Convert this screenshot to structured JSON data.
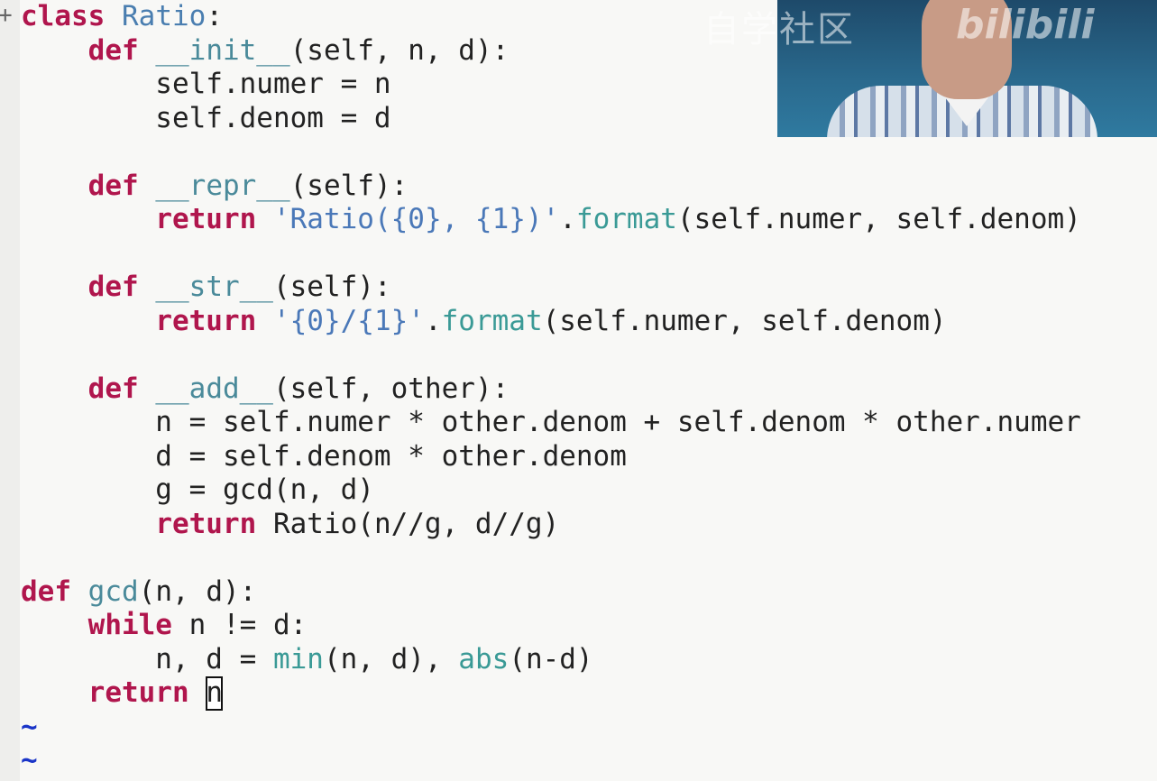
{
  "code_lines": [
    [
      {
        "t": "class",
        "c": "kw"
      },
      {
        "t": " "
      },
      {
        "t": "Ratio",
        "c": "cls"
      },
      {
        "t": ":"
      }
    ],
    [
      {
        "t": "    "
      },
      {
        "t": "def",
        "c": "kw"
      },
      {
        "t": " "
      },
      {
        "t": "__init__",
        "c": "fn"
      },
      {
        "t": "(self, n, d):"
      }
    ],
    [
      {
        "t": "        self.numer = n"
      }
    ],
    [
      {
        "t": "        self.denom = d"
      }
    ],
    [],
    [
      {
        "t": "    "
      },
      {
        "t": "def",
        "c": "kw"
      },
      {
        "t": " "
      },
      {
        "t": "__repr__",
        "c": "fn"
      },
      {
        "t": "(self):"
      }
    ],
    [
      {
        "t": "        "
      },
      {
        "t": "return",
        "c": "kw"
      },
      {
        "t": " "
      },
      {
        "t": "'Ratio({0}, {1})'",
        "c": "str"
      },
      {
        "t": "."
      },
      {
        "t": "format",
        "c": "builtin"
      },
      {
        "t": "(self.numer, self.denom)"
      }
    ],
    [],
    [
      {
        "t": "    "
      },
      {
        "t": "def",
        "c": "kw"
      },
      {
        "t": " "
      },
      {
        "t": "__str__",
        "c": "fn"
      },
      {
        "t": "(self):"
      }
    ],
    [
      {
        "t": "        "
      },
      {
        "t": "return",
        "c": "kw"
      },
      {
        "t": " "
      },
      {
        "t": "'{0}/{1}'",
        "c": "str"
      },
      {
        "t": "."
      },
      {
        "t": "format",
        "c": "builtin"
      },
      {
        "t": "(self.numer, self.denom)"
      }
    ],
    [],
    [
      {
        "t": "    "
      },
      {
        "t": "def",
        "c": "kw"
      },
      {
        "t": " "
      },
      {
        "t": "__add__",
        "c": "fn"
      },
      {
        "t": "(self, other):"
      }
    ],
    [
      {
        "t": "        n = self.numer * other.denom + self.denom * other.numer"
      }
    ],
    [
      {
        "t": "        d = self.denom * other.denom"
      }
    ],
    [
      {
        "t": "        g = gcd(n, d)"
      }
    ],
    [
      {
        "t": "        "
      },
      {
        "t": "return",
        "c": "kw"
      },
      {
        "t": " Ratio(n//g, d//g)"
      }
    ],
    [],
    [
      {
        "t": "def",
        "c": "kw"
      },
      {
        "t": " "
      },
      {
        "t": "gcd",
        "c": "fn"
      },
      {
        "t": "(n, d):"
      }
    ],
    [
      {
        "t": "    "
      },
      {
        "t": "while",
        "c": "kw"
      },
      {
        "t": " n != d:"
      }
    ],
    [
      {
        "t": "        n, d = "
      },
      {
        "t": "min",
        "c": "builtin"
      },
      {
        "t": "(n, d), "
      },
      {
        "t": "abs",
        "c": "builtin"
      },
      {
        "t": "(n-d)"
      }
    ],
    [
      {
        "t": "    "
      },
      {
        "t": "return",
        "c": "kw"
      },
      {
        "t": " "
      },
      {
        "t": "n",
        "c": "cursor"
      }
    ],
    [
      {
        "t": "~",
        "c": "tilde"
      }
    ],
    [
      {
        "t": "~",
        "c": "tilde"
      }
    ]
  ],
  "gutter_marker": "+",
  "video": {
    "watermark_text": "自学社区",
    "logo_text": "bilibili"
  }
}
